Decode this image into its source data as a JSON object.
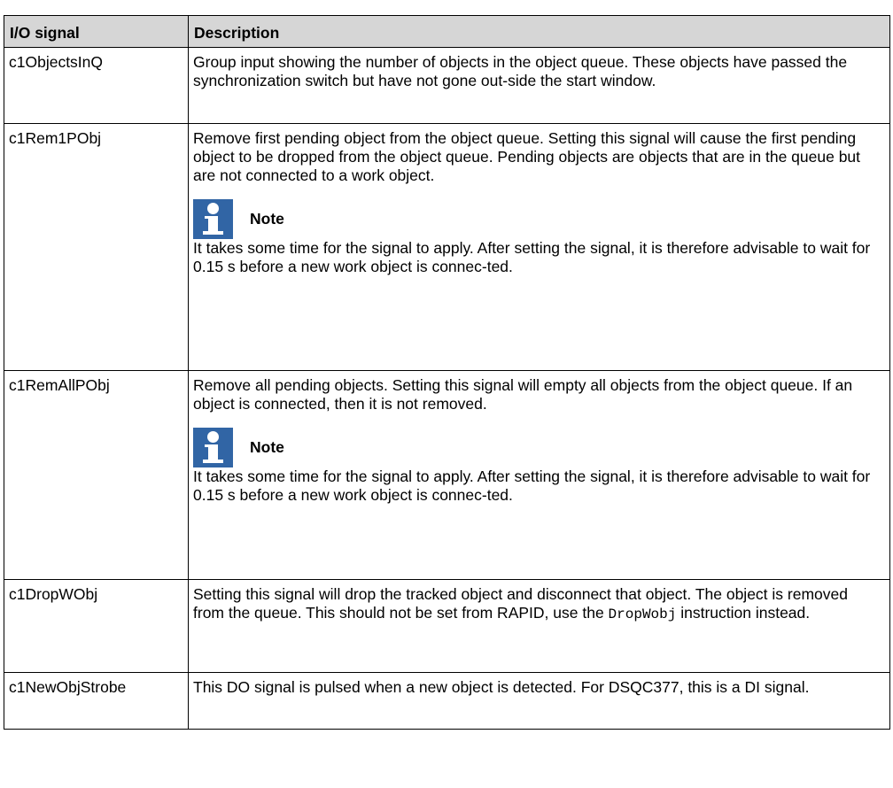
{
  "table": {
    "header": {
      "signal": "I/O signal",
      "description": "Description"
    },
    "rows": [
      {
        "signal": "c1ObjectsInQ",
        "description": "Group input showing the number of objects in the object queue. These objects have passed the synchronization switch but have not gone out-side the start window."
      },
      {
        "signal": "c1Rem1PObj",
        "description": "Remove first pending object from the object queue. Setting this signal will cause the first pending object to be dropped from the object queue. Pending objects are objects that are in the queue but are not connected to a work object.",
        "note_title": "Note",
        "note_text": "It takes some time for the signal to apply. After setting the signal, it is therefore advisable to wait for 0.15 s before a new work object is connec-ted."
      },
      {
        "signal": "c1RemAllPObj",
        "description": "Remove all pending objects. Setting this signal will empty all objects from the object queue. If an object is connected, then it is not removed.",
        "note_title": "Note",
        "note_text": "It takes some time for the signal to apply. After setting the signal, it is therefore advisable to wait for 0.15 s before a new work object is connec-ted."
      },
      {
        "signal": "c1DropWObj",
        "description_before": "Setting this signal will drop the tracked object and disconnect that object. The object is removed from the queue. This should not be set from RAPID, use the ",
        "description_code": "DropWobj",
        "description_after": " instruction instead."
      },
      {
        "signal": "c1NewObjStrobe",
        "description": "This DO signal is pulsed when a new object is detected. For DSQC377, this is a DI signal."
      }
    ]
  },
  "icons": {
    "note": "info-icon",
    "note_color": "#3165a5"
  }
}
